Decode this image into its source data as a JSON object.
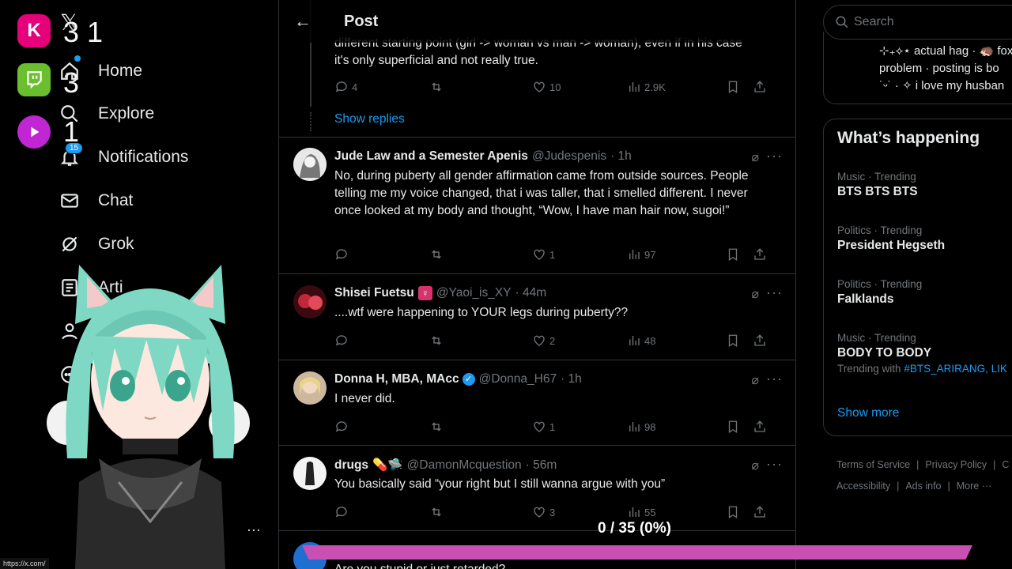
{
  "nav": {
    "items": [
      {
        "label": "Home"
      },
      {
        "label": "Explore"
      },
      {
        "label": "Notifications"
      },
      {
        "label": "Chat"
      },
      {
        "label": "Grok"
      },
      {
        "label": "Arti"
      }
    ],
    "notifications_badge": "15",
    "status_url": "https://x.com/"
  },
  "overlay": {
    "counts": [
      "3",
      "1",
      "3",
      "1"
    ],
    "progress_label": "0 / 35 (0%)",
    "progress_fraction": 0
  },
  "header": {
    "title": "Post"
  },
  "previous": {
    "text_line1": "different starting point (girl -> woman vs man -> woman), even if in his case",
    "text_line2": "it's only superficial and not really true.",
    "replies": "4",
    "likes": "10",
    "views": "2.9K",
    "show_replies": "Show replies"
  },
  "tweets": [
    {
      "name": "Jude Law and a Semester Apenis",
      "handle": "@Judespenis",
      "time": "· 1h",
      "body": "No, during puberty all gender affirmation came from outside sources. People telling me my voice changed, that i was taller, that i smelled different. I never once looked at my body and thought, “Wow, I have man hair now, sugoi!”",
      "replies": "",
      "likes": "1",
      "views": "97"
    },
    {
      "name": "Shisei Fuetsu",
      "handle": "@Yaoi_is_XY",
      "time": "· 44m",
      "body": "....wtf were happening to YOUR legs during puberty??",
      "replies": "",
      "likes": "2",
      "views": "48"
    },
    {
      "name": "Donna H, MBA, MAcc",
      "handle": "@Donna_H67",
      "time": "· 1h",
      "body": "I never did.",
      "replies": "",
      "likes": "1",
      "views": "98"
    },
    {
      "name": "drugs",
      "handle": "@DamonMcquestion",
      "time": "· 56m",
      "body": "You basically said “your right but I still wanna argue with you”",
      "replies": "",
      "likes": "3",
      "views": "55"
    },
    {
      "body": "Are you stupid or just retarded?"
    }
  ],
  "right": {
    "search_placeholder": "Search",
    "bio_lines": [
      "⊹₊⟡⋆ actual hag · 🦔 fox",
      "problem · posting is bo",
      "˙ᵕ˙ · ✧ i love my husban"
    ],
    "trends_title": "What’s happening",
    "trends": [
      {
        "meta": "Music · Trending",
        "title": "BTS BTS BTS"
      },
      {
        "meta": "Politics · Trending",
        "title": "President Hegseth"
      },
      {
        "meta": "Politics · Trending",
        "title": "Falklands"
      },
      {
        "meta": "Music · Trending",
        "title": "BODY TO BODY",
        "with_prefix": "Trending with",
        "with_tag": "#BTS_ARIRANG, LIK"
      }
    ],
    "show_more": "Show more",
    "footer": [
      "Terms of Service",
      "|",
      "Privacy Policy",
      "|",
      "C",
      "Accessibility",
      "|",
      "Ads info",
      "|",
      "More ···"
    ]
  }
}
